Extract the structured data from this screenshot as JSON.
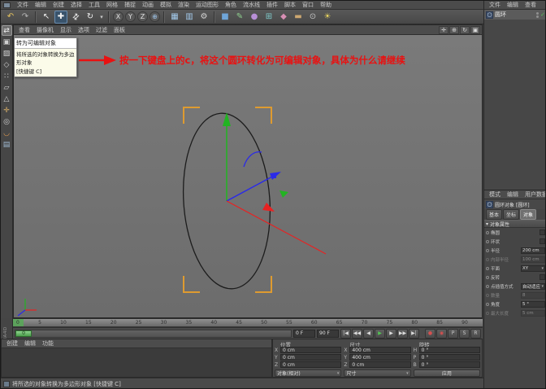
{
  "app": {
    "status_text": "将所选的对象转换为多边形对象 [快捷键 C]",
    "brand": "MAXON CINEMA4D"
  },
  "menubar": {
    "items": [
      {
        "label": "文件"
      },
      {
        "label": "编辑"
      },
      {
        "label": "创建"
      },
      {
        "label": "选择"
      },
      {
        "label": "工具"
      },
      {
        "label": "网格"
      },
      {
        "label": "捕捉"
      },
      {
        "label": "动画"
      },
      {
        "label": "模拟"
      },
      {
        "label": "渲染"
      },
      {
        "label": "运动图形"
      },
      {
        "label": "角色"
      },
      {
        "label": "流水线"
      },
      {
        "label": "插件"
      },
      {
        "label": "脚本"
      },
      {
        "label": "窗口"
      },
      {
        "label": "帮助"
      }
    ]
  },
  "toolbar": {
    "items": [
      {
        "name": "undo-icon",
        "glyph": "↶",
        "color": "#e6c35c",
        "cls": "",
        "inter": "true"
      },
      {
        "name": "redo-icon",
        "glyph": "↷",
        "color": "#b5b5b5",
        "cls": "",
        "inter": "true"
      },
      {
        "name": "toolbar-separator",
        "glyph": "",
        "color": "",
        "cls": "sep",
        "inter": "false"
      },
      {
        "name": "live-selection-icon",
        "glyph": "↖",
        "color": "#f0f0f0",
        "cls": "",
        "inter": "true"
      },
      {
        "name": "move-tool-icon",
        "glyph": "✚",
        "color": "#f0f0f0",
        "cls": "active",
        "inter": "true"
      },
      {
        "name": "scale-tool-icon",
        "glyph": "⇅",
        "color": "#f0f0f0",
        "cls": "rot45",
        "inter": "true"
      },
      {
        "name": "rotate-tool-icon",
        "glyph": "↻",
        "color": "#f0f0f0",
        "cls": "",
        "inter": "true"
      },
      {
        "name": "last-tool-icon",
        "glyph": "▾",
        "color": "#c8c8c8",
        "cls": "narrow",
        "inter": "true"
      },
      {
        "name": "toolbar-separator",
        "glyph": "",
        "color": "",
        "cls": "sep",
        "inter": "false"
      },
      {
        "name": "lock-x-icon",
        "glyph": "X",
        "color": "#e0e0e0",
        "cls": "circle",
        "inter": "true"
      },
      {
        "name": "lock-y-icon",
        "glyph": "Y",
        "color": "#e0e0e0",
        "cls": "circle",
        "inter": "true"
      },
      {
        "name": "lock-z-icon",
        "glyph": "Z",
        "color": "#e0e0e0",
        "cls": "circle",
        "inter": "true"
      },
      {
        "name": "coordinate-system-icon",
        "glyph": "⊕",
        "color": "#9cc2e6",
        "cls": "circle",
        "inter": "true"
      },
      {
        "name": "toolbar-separator",
        "glyph": "",
        "color": "",
        "cls": "sep",
        "inter": "false"
      },
      {
        "name": "render-view-icon",
        "glyph": "▦",
        "color": "#a3c9ea",
        "cls": "",
        "inter": "true"
      },
      {
        "name": "render-picture-viewer-icon",
        "glyph": "▥",
        "color": "#a3c9ea",
        "cls": "",
        "inter": "true"
      },
      {
        "name": "render-settings-icon",
        "glyph": "⚙",
        "color": "#d6d6d6",
        "cls": "",
        "inter": "true"
      },
      {
        "name": "toolbar-separator",
        "glyph": "",
        "color": "",
        "cls": "sep",
        "inter": "false"
      },
      {
        "name": "add-cube-icon",
        "glyph": "■",
        "color": "#6fa5d8",
        "cls": "",
        "inter": "true"
      },
      {
        "name": "spline-pen-icon",
        "glyph": "✎",
        "color": "#8fd18f",
        "cls": "",
        "inter": "true"
      },
      {
        "name": "subdivision-surface-icon",
        "glyph": "●",
        "color": "#b78fd6",
        "cls": "",
        "inter": "true"
      },
      {
        "name": "array-generator-icon",
        "glyph": "⊞",
        "color": "#7fc9c9",
        "cls": "",
        "inter": "true"
      },
      {
        "name": "deformer-icon",
        "glyph": "◆",
        "color": "#d88fb4",
        "cls": "",
        "inter": "true"
      },
      {
        "name": "floor-object-icon",
        "glyph": "▬",
        "color": "#cda871",
        "cls": "",
        "inter": "true"
      },
      {
        "name": "camera-icon",
        "glyph": "⊙",
        "color": "#c9c9c9",
        "cls": "",
        "inter": "true"
      },
      {
        "name": "light-icon",
        "glyph": "☀",
        "color": "#e8d45f",
        "cls": "",
        "inter": "true"
      }
    ]
  },
  "left_toolbar": {
    "items": [
      {
        "name": "make-editable-icon",
        "glyph": "⇄",
        "color": "#f0f0f0",
        "cls": "active",
        "inter": "true"
      },
      {
        "name": "model-mode-icon",
        "glyph": "▣",
        "color": "#cfcfcf",
        "cls": "",
        "inter": "true"
      },
      {
        "name": "texture-mode-icon",
        "glyph": "▨",
        "color": "#cfcfcf",
        "cls": "",
        "inter": "true"
      },
      {
        "name": "workplane-mode-icon",
        "glyph": "◇",
        "color": "#cfcfcf",
        "cls": "",
        "inter": "true"
      },
      {
        "name": "points-mode-icon",
        "glyph": "∷",
        "color": "#cfcfcf",
        "cls": "",
        "inter": "true"
      },
      {
        "name": "edges-mode-icon",
        "glyph": "▱",
        "color": "#cfcfcf",
        "cls": "",
        "inter": "true"
      },
      {
        "name": "polygons-mode-icon",
        "glyph": "△",
        "color": "#cfcfcf",
        "cls": "",
        "inter": "true"
      },
      {
        "name": "object-axis-icon",
        "glyph": "✛",
        "color": "#e0b469",
        "cls": "",
        "inter": "true"
      },
      {
        "name": "viewport-solo-icon",
        "glyph": "◎",
        "color": "#cfcfcf",
        "cls": "",
        "inter": "true"
      },
      {
        "name": "snapping-icon",
        "glyph": "◡",
        "color": "#e09a50",
        "cls": "",
        "inter": "true"
      },
      {
        "name": "lock-workplane-icon",
        "glyph": "▤",
        "color": "#9fb8d0",
        "cls": "",
        "inter": "true"
      }
    ]
  },
  "viewport": {
    "menus": [
      {
        "label": "查看"
      },
      {
        "label": "摄像机"
      },
      {
        "label": "显示"
      },
      {
        "label": "选项"
      },
      {
        "label": "过滤"
      },
      {
        "label": "面板"
      }
    ],
    "nav": [
      {
        "name": "pan-view-icon",
        "glyph": "✛"
      },
      {
        "name": "zoom-view-icon",
        "glyph": "⊕"
      },
      {
        "name": "rotate-view-icon",
        "glyph": "↻"
      },
      {
        "name": "toggle-view-icon",
        "glyph": "▣"
      }
    ],
    "tooltip": {
      "title": "转为可编辑对象",
      "desc": "将所选的对象转换为多边形对象",
      "shortcut": "[快捷键 C]"
    },
    "annotation": {
      "text": "按一下键盘上的c，将这个圆环转化为可编辑对象，具体为什么请继续",
      "color": "#e81212"
    },
    "colors": {
      "axis_x": "#e82222",
      "axis_y": "#22b422",
      "axis_z": "#2a2ae8",
      "bracket": "#de9b30",
      "spline": "#1c1c1c"
    }
  },
  "timeline": {
    "ticks": [
      {
        "label": "0"
      },
      {
        "label": "5"
      },
      {
        "label": "10"
      },
      {
        "label": "15"
      },
      {
        "label": "20"
      },
      {
        "label": "25"
      },
      {
        "label": "30"
      },
      {
        "label": "35"
      },
      {
        "label": "40"
      },
      {
        "label": "45"
      },
      {
        "label": "50"
      },
      {
        "label": "55"
      },
      {
        "label": "60"
      },
      {
        "label": "65"
      },
      {
        "label": "70"
      },
      {
        "label": "75"
      },
      {
        "label": "80"
      },
      {
        "label": "85"
      },
      {
        "label": "90"
      }
    ],
    "current": "0",
    "start": "0 F",
    "end": "90 F",
    "playback": [
      {
        "name": "goto-start-button",
        "glyph": "|◀",
        "color": "#dcdcdc",
        "cls": "",
        "inter": "true"
      },
      {
        "name": "prev-key-button",
        "glyph": "◀◀",
        "color": "#dcdcdc",
        "cls": "",
        "inter": "true"
      },
      {
        "name": "prev-frame-button",
        "glyph": "◀",
        "color": "#dcdcdc",
        "cls": "",
        "inter": "true"
      },
      {
        "name": "play-button",
        "glyph": "▶",
        "color": "#52c552",
        "cls": "",
        "inter": "true"
      },
      {
        "name": "next-frame-button",
        "glyph": "▶",
        "color": "#dcdcdc",
        "cls": "",
        "inter": "true"
      },
      {
        "name": "next-key-button",
        "glyph": "▶▶",
        "color": "#dcdcdc",
        "cls": "",
        "inter": "true"
      },
      {
        "name": "goto-end-button",
        "glyph": "▶|",
        "color": "#dcdcdc",
        "cls": "",
        "inter": "true"
      },
      {
        "name": "playback-gap",
        "glyph": "",
        "color": "",
        "cls": "gap",
        "inter": "false"
      },
      {
        "name": "record-keyframe-button",
        "glyph": "●",
        "color": "#d65050",
        "cls": "",
        "inter": "true"
      },
      {
        "name": "autokey-button",
        "glyph": "◉",
        "color": "#d65050",
        "cls": "",
        "inter": "true"
      },
      {
        "name": "record-position-button",
        "glyph": "P",
        "color": "#c8c8c8",
        "cls": "",
        "inter": "true"
      },
      {
        "name": "record-scale-button",
        "glyph": "S",
        "color": "#c8c8c8",
        "cls": "",
        "inter": "true"
      },
      {
        "name": "record-rotation-button",
        "glyph": "R",
        "color": "#c8c8c8",
        "cls": "",
        "inter": "true"
      }
    ]
  },
  "materials": {
    "menus": [
      {
        "label": "创建"
      },
      {
        "label": "编辑"
      },
      {
        "label": "功能"
      }
    ]
  },
  "coordinates": {
    "pos_title": "位置",
    "size_title": "尺寸",
    "rot_title": "旋转",
    "position": [
      {
        "axis": "X",
        "value": "0 cm"
      },
      {
        "axis": "Y",
        "value": "0 cm"
      },
      {
        "axis": "Z",
        "value": "0 cm"
      }
    ],
    "size": [
      {
        "axis": "X",
        "value": "400 cm"
      },
      {
        "axis": "Y",
        "value": "400 cm"
      },
      {
        "axis": "Z",
        "value": "0 cm"
      }
    ],
    "rotation": [
      {
        "axis": "H",
        "value": "0 °"
      },
      {
        "axis": "P",
        "value": "0 °"
      },
      {
        "axis": "B",
        "value": "0 °"
      }
    ],
    "space": "对象(相对)",
    "size_mode": "尺寸",
    "apply": "应用"
  },
  "object_manager": {
    "menus": [
      {
        "label": "文件"
      },
      {
        "label": "编辑"
      },
      {
        "label": "查看"
      }
    ],
    "object": {
      "icon": "○",
      "name": "圆环",
      "check": "✓"
    }
  },
  "attributes": {
    "menus": [
      {
        "label": "模式"
      },
      {
        "label": "编辑"
      },
      {
        "label": "用户数据"
      }
    ],
    "icon": "○",
    "title": "圆环对象 [圆环]",
    "tabs": [
      {
        "label": "基本",
        "active": ""
      },
      {
        "label": "坐标",
        "active": ""
      },
      {
        "label": "对象",
        "active": "active"
      }
    ],
    "section": "对象属性",
    "rows": [
      {
        "label": "椭圆",
        "control": "checkbox",
        "value": "",
        "disabled": ""
      },
      {
        "label": "环状",
        "control": "checkbox",
        "value": "",
        "disabled": ""
      },
      {
        "label": "半径",
        "control": "number",
        "value": "200 cm",
        "disabled": ""
      },
      {
        "label": "内部半径",
        "control": "number",
        "value": "100 cm",
        "disabled": "disabled"
      },
      {
        "label": "平面",
        "control": "dropdown",
        "value": "XY",
        "disabled": ""
      },
      {
        "label": "反转",
        "control": "checkbox",
        "value": "",
        "disabled": ""
      },
      {
        "label": "点插值方式",
        "control": "dropdown",
        "value": "自动适应",
        "disabled": ""
      },
      {
        "label": "数量",
        "control": "number",
        "value": "8",
        "disabled": "disabled"
      },
      {
        "label": "角度",
        "control": "number",
        "value": "5 °",
        "disabled": ""
      },
      {
        "label": "最大长度",
        "control": "number",
        "value": "5 cm",
        "disabled": "disabled"
      }
    ]
  }
}
